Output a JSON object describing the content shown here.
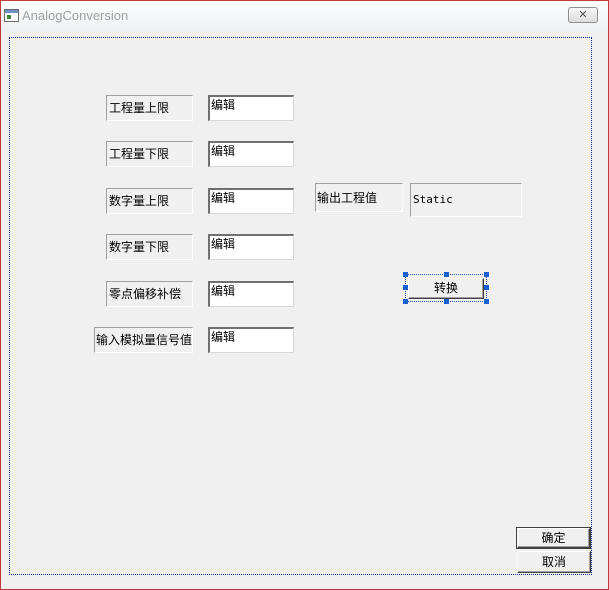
{
  "window": {
    "title": "AnalogConversion",
    "close_label": "✕"
  },
  "form": {
    "fields": [
      {
        "label": "工程量上限",
        "value": "编辑"
      },
      {
        "label": "工程量下限",
        "value": "编辑"
      },
      {
        "label": "数字量上限",
        "value": "编辑"
      },
      {
        "label": "数字量下限",
        "value": "编辑"
      },
      {
        "label": "零点偏移补偿",
        "value": "编辑"
      },
      {
        "label": "输入模拟量信号值",
        "value": "编辑"
      }
    ],
    "output_label": "输出工程值",
    "output_value": "Static",
    "convert_label": "转换"
  },
  "footer": {
    "ok_label": "确定",
    "cancel_label": "取消"
  }
}
